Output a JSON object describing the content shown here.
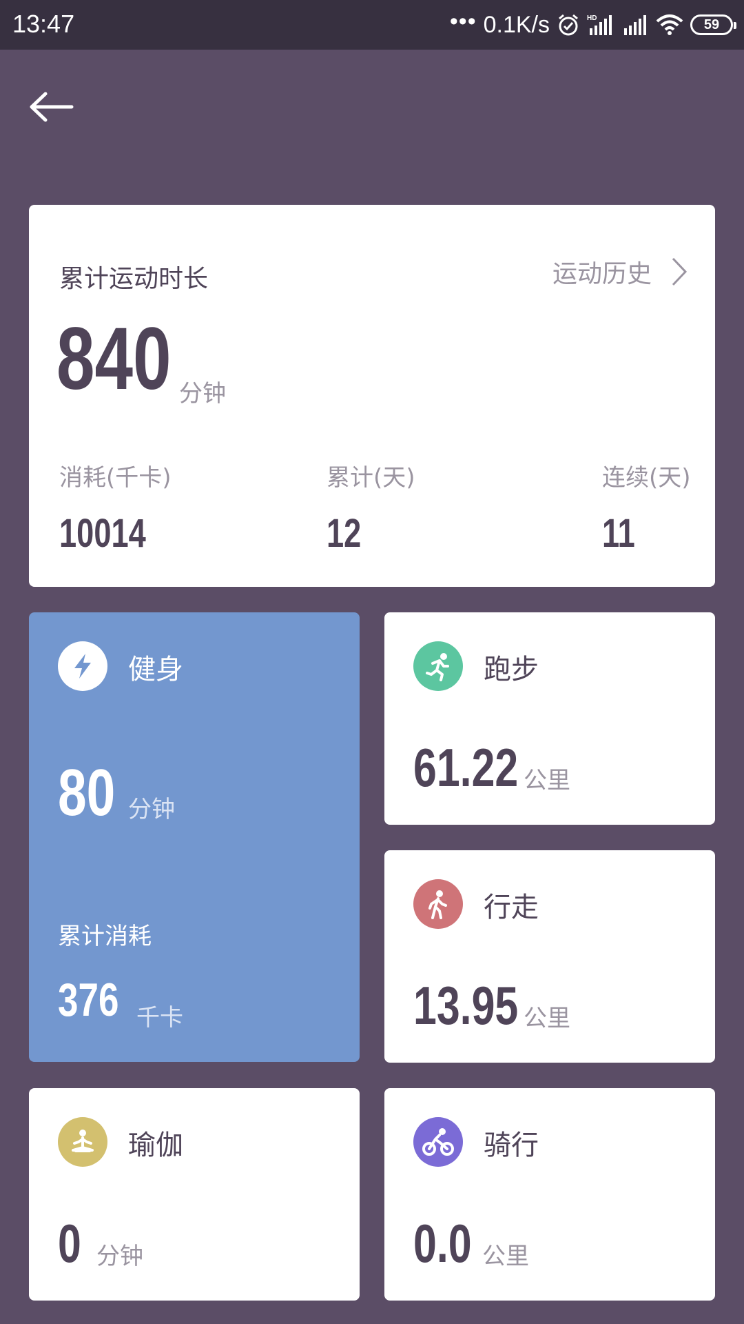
{
  "status_bar": {
    "time": "13:47",
    "dots": "•••",
    "net_speed": "0.1K/s",
    "battery": "59"
  },
  "summary": {
    "title": "累计运动时长",
    "history_link": "运动历史",
    "total_minutes": "840",
    "total_unit": "分钟",
    "stats": [
      {
        "label": "消耗(千卡)",
        "value": "10014"
      },
      {
        "label": "累计(天)",
        "value": "12"
      },
      {
        "label": "连续(天)",
        "value": "11"
      }
    ]
  },
  "fitness": {
    "name": "健身",
    "value": "80",
    "unit": "分钟",
    "sub_label": "累计消耗",
    "sub_value": "376",
    "sub_unit": "千卡",
    "color": "#7397cf"
  },
  "running": {
    "name": "跑步",
    "value": "61.22",
    "unit": "公里",
    "icon": "running-icon",
    "color": "#5cc6a0"
  },
  "walking": {
    "name": "行走",
    "value": "13.95",
    "unit": "公里",
    "icon": "walking-icon",
    "color": "#cf7478"
  },
  "yoga": {
    "name": "瑜伽",
    "value": "0",
    "unit": "分钟",
    "icon": "yoga-icon",
    "color": "#d3c06f"
  },
  "cycling": {
    "name": "骑行",
    "value": "0.0",
    "unit": "公里",
    "icon": "cycling-icon",
    "color": "#7b6bd6"
  }
}
